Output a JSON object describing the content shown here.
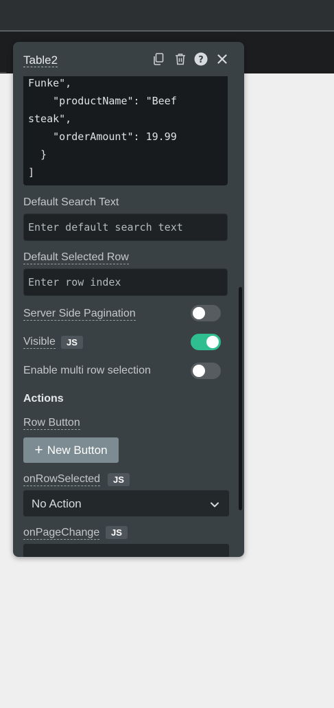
{
  "panel": {
    "title": "Table2",
    "header_icons": [
      "copy-icon",
      "trash-icon",
      "help-icon",
      "close-icon"
    ]
  },
  "code": {
    "lines": [
      "Funke\",",
      "    \"productName\": \"Beef",
      "steak\",",
      "    \"orderAmount\": 19.99",
      "  }",
      "]"
    ]
  },
  "default_search": {
    "label": "Default Search Text",
    "placeholder": "Enter default search text"
  },
  "default_row": {
    "label": "Default Selected Row",
    "placeholder": "Enter row index"
  },
  "toggles": {
    "server_side": {
      "label": "Server Side Pagination",
      "on": false
    },
    "visible": {
      "label": "Visible",
      "badge": "JS",
      "on": true
    },
    "multi_row": {
      "label": "Enable multi row selection",
      "on": false
    }
  },
  "actions": {
    "title": "Actions",
    "row_button_label": "Row Button",
    "new_button_label": "New Button",
    "on_row_selected": {
      "label": "onRowSelected",
      "badge": "JS",
      "value": "No Action"
    },
    "on_page_change": {
      "label": "onPageChange",
      "badge": "JS"
    }
  },
  "colors": {
    "panel_bg": "#3a4145",
    "toggle_on": "#2fbe8f",
    "toggle_off": "#565c60",
    "code_bg": "#181b1d"
  }
}
